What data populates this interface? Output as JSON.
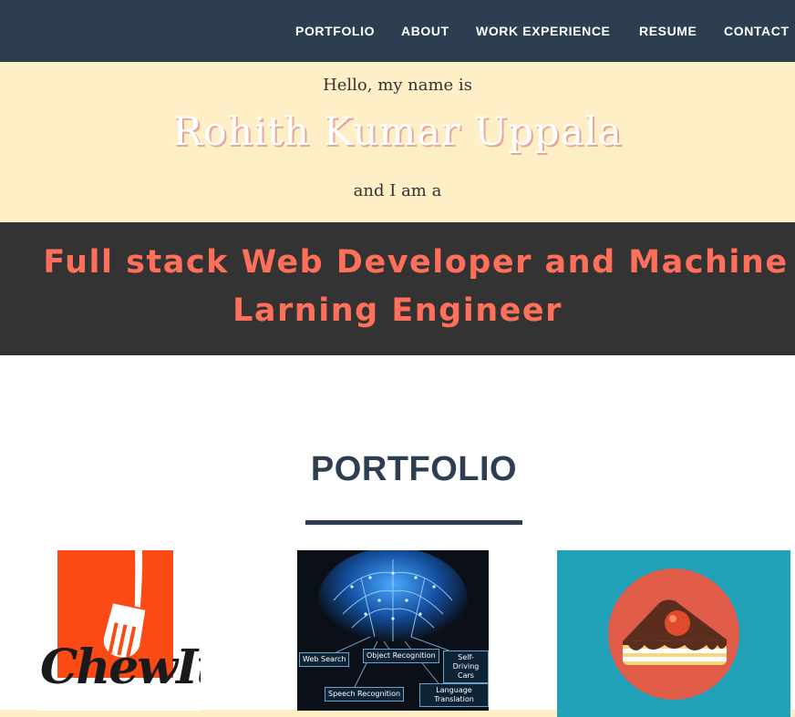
{
  "nav": {
    "items": [
      "PORTFOLIO",
      "ABOUT",
      "WORK EXPERIENCE",
      "RESUME",
      "CONTACT"
    ]
  },
  "hero": {
    "greeting": "Hello, my name is",
    "name": "Rohith Kumar Uppala",
    "and_i_am": "and I am a"
  },
  "role": {
    "line1": "Full stack Web Developer and Machine",
    "line2": "Larning Engineer"
  },
  "portfolio": {
    "title": "PORTFOLIO",
    "tiles": [
      {
        "logo_text": "ChewIt"
      },
      {
        "labels": [
          "Web Search",
          "Object Recognition",
          "Self-Driving Cars",
          "Speech Recognition",
          "Language Translation"
        ]
      },
      {}
    ]
  },
  "colors": {
    "nav_bg": "#2c3e50",
    "hero_bg": "#ffefc7",
    "role_bg": "#333333",
    "accent": "#ff6f59",
    "cake_bg": "#21a1b7",
    "chew_orange": "#fc4a14"
  }
}
